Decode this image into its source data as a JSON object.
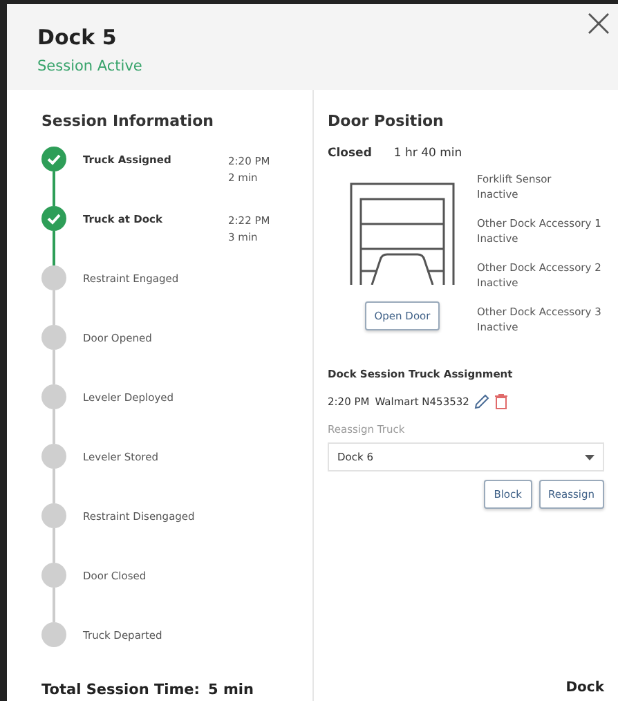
{
  "window": {
    "title": "Dock 5",
    "status": "Session Active"
  },
  "session": {
    "heading": "Session Information",
    "steps": [
      {
        "label": "Truck Assigned",
        "done": true,
        "time": "2:20 PM",
        "duration": "2 min"
      },
      {
        "label": "Truck at Dock",
        "done": true,
        "time": "2:22 PM",
        "duration": "3 min"
      },
      {
        "label": "Restraint Engaged",
        "done": false
      },
      {
        "label": "Door Opened",
        "done": false
      },
      {
        "label": "Leveler Deployed",
        "done": false
      },
      {
        "label": "Leveler Stored",
        "done": false
      },
      {
        "label": "Restraint Disengaged",
        "done": false
      },
      {
        "label": "Door Closed",
        "done": false
      },
      {
        "label": "Truck Departed",
        "done": false
      }
    ],
    "total_label": "Total Session Time:",
    "total_value": "5 min"
  },
  "door": {
    "heading": "Door Position",
    "state": "Closed",
    "duration": "1 hr 40 min",
    "open_button": "Open Door",
    "accessories": [
      {
        "name": "Forklift Sensor",
        "status": "Inactive"
      },
      {
        "name": "Other Dock Accessory 1",
        "status": "Inactive"
      },
      {
        "name": "Other Dock Accessory 2",
        "status": "Inactive"
      },
      {
        "name": "Other Dock Accessory 3",
        "status": "Inactive"
      }
    ]
  },
  "assignment": {
    "heading": "Dock Session Truck Assignment",
    "time": "2:20 PM",
    "truck": "Walmart N453532",
    "reassign_label": "Reassign Truck",
    "reassign_value": "Dock 6",
    "buttons": [
      "Block",
      "Reassign"
    ]
  },
  "logo": "Dock"
}
